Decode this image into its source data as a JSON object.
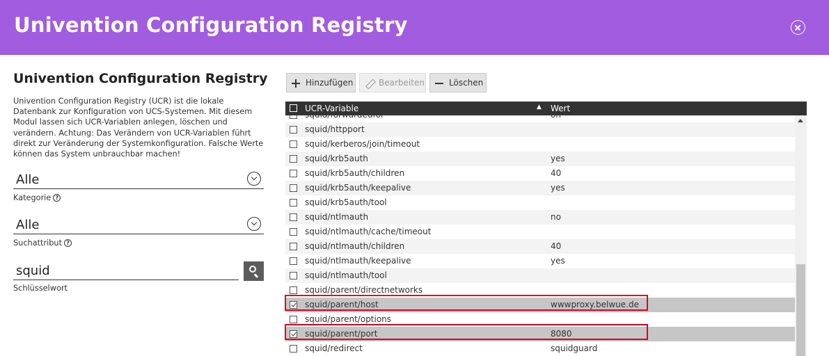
{
  "header": {
    "title": "Univention Configuration Registry"
  },
  "sidebar": {
    "title": "Univention Configuration Registry",
    "description": "Univention Configuration Registry (UCR) ist die lokale Datenbank zur Konfiguration von UCS-Systemen. Mit diesem Modul lassen sich UCR-Variablen anlegen, löschen und verändern. Achtung: Das Verändern von UCR-Variablen führt direkt zur Veränderung der Systemkonfiguration. Falsche Werte können das System unbrauchbar machen!",
    "category": {
      "value": "Alle",
      "label": "Kategorie"
    },
    "search_attribute": {
      "value": "Alle",
      "label": "Suchattribut"
    },
    "keyword": {
      "value": "squid",
      "label": "Schlüsselwort"
    }
  },
  "toolbar": {
    "add": "Hinzufügen",
    "edit": "Bearbeiten",
    "delete": "Löschen"
  },
  "grid": {
    "columns": [
      "UCR-Variable",
      "Wert"
    ],
    "rows": [
      {
        "key": "squid/forwardedfor",
        "value": "on",
        "checked": false
      },
      {
        "key": "squid/httpport",
        "value": "",
        "checked": false
      },
      {
        "key": "squid/kerberos/join/timeout",
        "value": "",
        "checked": false
      },
      {
        "key": "squid/krb5auth",
        "value": "yes",
        "checked": false
      },
      {
        "key": "squid/krb5auth/children",
        "value": "40",
        "checked": false
      },
      {
        "key": "squid/krb5auth/keepalive",
        "value": "yes",
        "checked": false
      },
      {
        "key": "squid/krb5auth/tool",
        "value": "",
        "checked": false
      },
      {
        "key": "squid/ntlmauth",
        "value": "no",
        "checked": false
      },
      {
        "key": "squid/ntlmauth/cache/timeout",
        "value": "",
        "checked": false
      },
      {
        "key": "squid/ntlmauth/children",
        "value": "40",
        "checked": false
      },
      {
        "key": "squid/ntlmauth/keepalive",
        "value": "yes",
        "checked": false
      },
      {
        "key": "squid/ntlmauth/tool",
        "value": "",
        "checked": false
      },
      {
        "key": "squid/parent/directnetworks",
        "value": "",
        "checked": false
      },
      {
        "key": "squid/parent/host",
        "value": "wwwproxy.belwue.de",
        "checked": true
      },
      {
        "key": "squid/parent/options",
        "value": "",
        "checked": false
      },
      {
        "key": "squid/parent/port",
        "value": "8080",
        "checked": true
      },
      {
        "key": "squid/redirect",
        "value": "squidguard",
        "checked": false
      }
    ]
  },
  "colors": {
    "header": "#a15ce0",
    "grid_header": "#333333",
    "highlight": "#e0001a"
  }
}
